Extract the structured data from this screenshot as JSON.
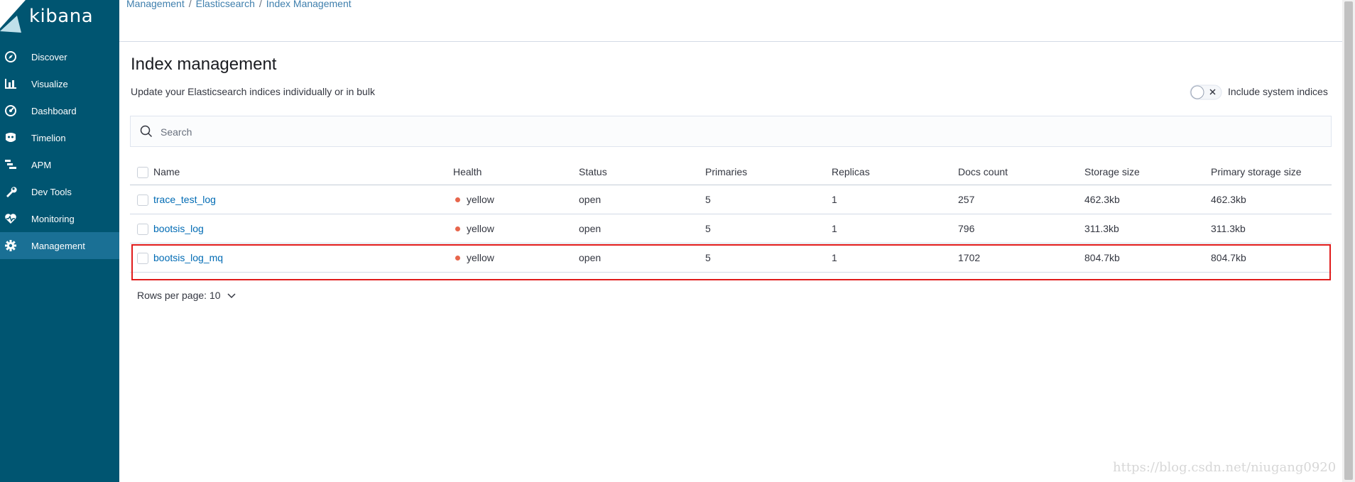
{
  "app": {
    "brand": "kibana",
    "accent": "#005571",
    "active_nav_bg": "#1a7095",
    "link_color": "#006bb4"
  },
  "sidebar": {
    "items": [
      {
        "label": "Discover",
        "icon": "compass-icon"
      },
      {
        "label": "Visualize",
        "icon": "bar-chart-icon"
      },
      {
        "label": "Dashboard",
        "icon": "dashboard-icon"
      },
      {
        "label": "Timelion",
        "icon": "timelion-icon"
      },
      {
        "label": "APM",
        "icon": "apm-icon"
      },
      {
        "label": "Dev Tools",
        "icon": "wrench-icon"
      },
      {
        "label": "Monitoring",
        "icon": "heartbeat-icon"
      },
      {
        "label": "Management",
        "icon": "gear-icon",
        "active": true
      }
    ]
  },
  "breadcrumb": [
    "Management",
    "Elasticsearch",
    "Index Management"
  ],
  "page": {
    "title": "Index management",
    "subtitle": "Update your Elasticsearch indices individually or in bulk",
    "system_toggle_label": "Include system indices"
  },
  "search": {
    "placeholder": "Search",
    "value": ""
  },
  "table": {
    "columns": [
      "Name",
      "Health",
      "Status",
      "Primaries",
      "Replicas",
      "Docs count",
      "Storage size",
      "Primary storage size"
    ],
    "rows": [
      {
        "name": "trace_test_log",
        "health": "yellow",
        "status": "open",
        "primaries": "5",
        "replicas": "1",
        "docs_count": "257",
        "storage_size": "462.3kb",
        "primary_storage_size": "462.3kb"
      },
      {
        "name": "bootsis_log",
        "health": "yellow",
        "status": "open",
        "primaries": "5",
        "replicas": "1",
        "docs_count": "796",
        "storage_size": "311.3kb",
        "primary_storage_size": "311.3kb"
      },
      {
        "name": "bootsis_log_mq",
        "health": "yellow",
        "status": "open",
        "primaries": "5",
        "replicas": "1",
        "docs_count": "1702",
        "storage_size": "804.7kb",
        "primary_storage_size": "804.7kb"
      }
    ],
    "health_color": "#e7664c",
    "highlight_color": "#e01b1b"
  },
  "pagination": {
    "rows_per_page_label": "Rows per page: 10"
  },
  "watermark": "https://blog.csdn.net/niugang0920"
}
